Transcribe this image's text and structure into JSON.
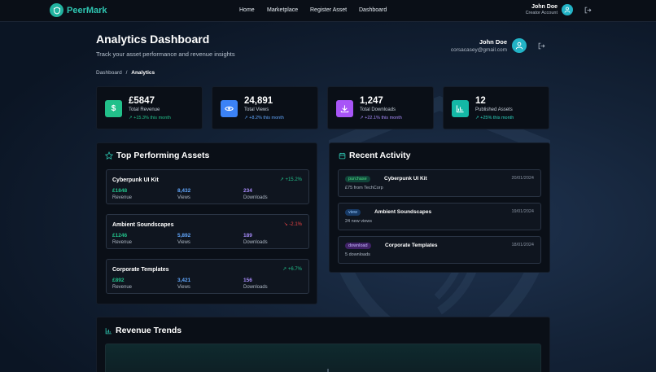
{
  "nav": {
    "brand": "PeerMark",
    "links": [
      "Home",
      "Marketplace",
      "Register Asset",
      "Dashboard"
    ],
    "user_name": "John Doe",
    "user_role": "Creator Account"
  },
  "header": {
    "title": "Analytics Dashboard",
    "subtitle": "Track your asset performance and revenue insights",
    "user_name": "John Doe",
    "user_email": "corsacasey@gmail.com",
    "breadcrumb_root": "Dashboard",
    "breadcrumb_sep": "/",
    "breadcrumb_current": "Analytics"
  },
  "stats": [
    {
      "value": "£5847",
      "label": "Total Revenue",
      "change": "+15.3% this month",
      "icon": "pound-icon",
      "color": "#22c08a"
    },
    {
      "value": "24,891",
      "label": "Total Views",
      "change": "+8.2% this month",
      "icon": "eye-icon",
      "color": "#3b82f6"
    },
    {
      "value": "1,247",
      "label": "Total Downloads",
      "change": "+22.1% this month",
      "icon": "download-icon",
      "color": "#a855f7"
    },
    {
      "value": "12",
      "label": "Published Assets",
      "change": "+25% this month",
      "icon": "bar-chart-icon",
      "color": "#14b8a6"
    }
  ],
  "top_assets": {
    "title": "Top Performing Assets",
    "revenue_label": "Revenue",
    "views_label": "Views",
    "downloads_label": "Downloads",
    "items": [
      {
        "name": "Cyberpunk UI Kit",
        "change": "+15.2%",
        "trend": "up",
        "revenue": "£1848",
        "views": "8,432",
        "downloads": "234"
      },
      {
        "name": "Ambient Soundscapes",
        "change": "-2.1%",
        "trend": "down",
        "revenue": "£1246",
        "views": "5,892",
        "downloads": "189"
      },
      {
        "name": "Corporate Templates",
        "change": "+6.7%",
        "trend": "up",
        "revenue": "£892",
        "views": "3,421",
        "downloads": "156"
      }
    ]
  },
  "recent_activity": {
    "title": "Recent Activity",
    "items": [
      {
        "tag": "purchase",
        "title": "Cyberpunk UI Kit",
        "date": "20/01/2024",
        "desc": "£75 from TechCorp"
      },
      {
        "tag": "view",
        "title": "Ambient Soundscapes",
        "date": "19/01/2024",
        "desc": "24 new views"
      },
      {
        "tag": "download",
        "title": "Corporate Templates",
        "date": "18/01/2024",
        "desc": "5 downloads"
      }
    ]
  },
  "revenue_trends": {
    "title": "Revenue Trends"
  },
  "colors": {
    "accent": "#2ec4b0",
    "up": "#22c08a",
    "down": "#ef4444",
    "views": "#60a5fa",
    "downloads": "#a78bfa"
  }
}
